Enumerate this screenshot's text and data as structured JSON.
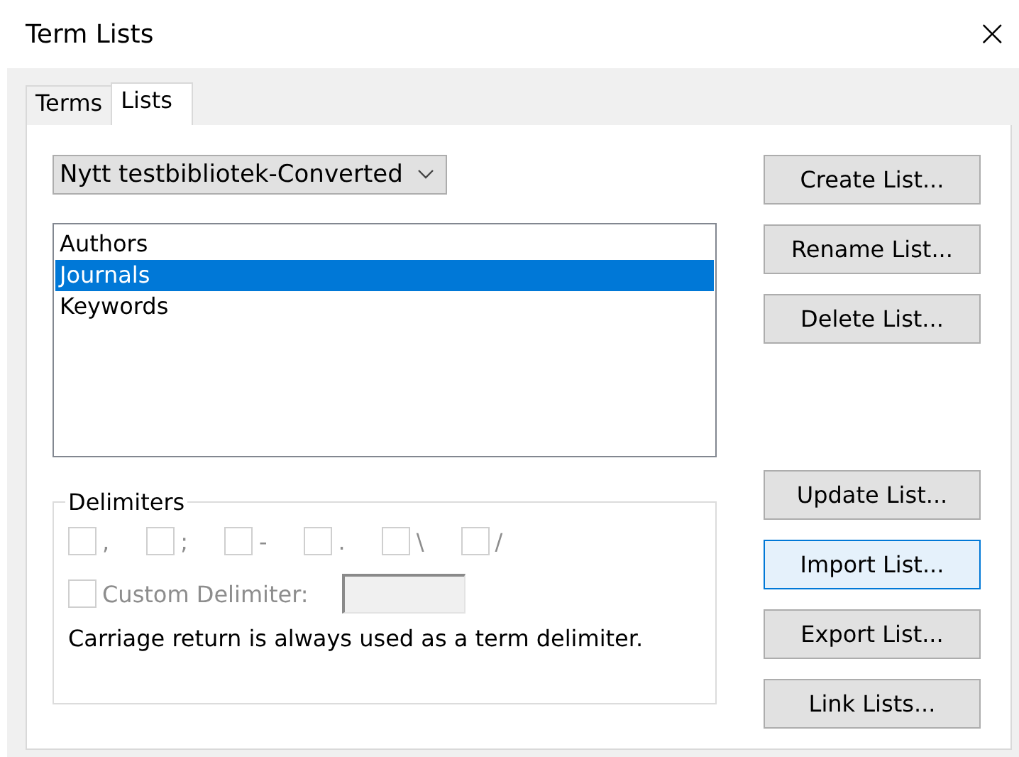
{
  "window": {
    "title": "Term Lists",
    "close": "×"
  },
  "tabs": [
    {
      "label": "Terms",
      "selected": false
    },
    {
      "label": "Lists",
      "selected": true
    }
  ],
  "library_dropdown": {
    "value": "Nytt testbibliotek-Converted"
  },
  "lists": [
    {
      "label": "Authors",
      "selected": false
    },
    {
      "label": "Journals",
      "selected": true
    },
    {
      "label": "Keywords",
      "selected": false
    }
  ],
  "delimiters": {
    "title": "Delimiters",
    "disabled": true,
    "options": [
      {
        "label": ",",
        "checked": false
      },
      {
        "label": ";",
        "checked": false
      },
      {
        "label": "-",
        "checked": false
      },
      {
        "label": ".",
        "checked": false
      },
      {
        "label": "\\",
        "checked": false
      },
      {
        "label": "/",
        "checked": false
      }
    ],
    "custom": {
      "label": "Custom Delimiter:",
      "checked": false
    },
    "note": "Carriage return is always used as a term delimiter."
  },
  "buttons_top": [
    {
      "label": "Create List...",
      "hovered": false
    },
    {
      "label": "Rename List...",
      "hovered": false
    },
    {
      "label": "Delete List...",
      "hovered": false
    }
  ],
  "buttons_bottom": [
    {
      "label": "Update List...",
      "hovered": false
    },
    {
      "label": "Import List...",
      "hovered": true
    },
    {
      "label": "Export List...",
      "hovered": false
    },
    {
      "label": "Link Lists...",
      "hovered": false
    }
  ]
}
